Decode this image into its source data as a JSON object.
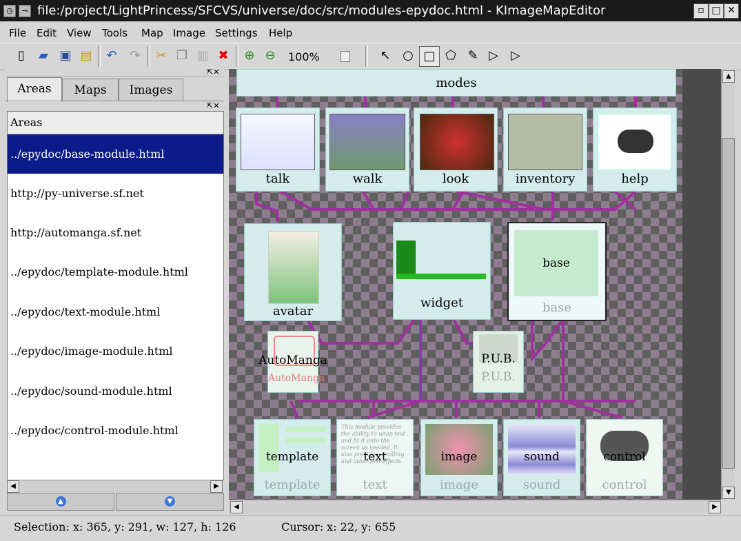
{
  "window": {
    "title": "file:/project/LightPrincess/SFCVS/universe/doc/src/modules-epydoc.html - KImageMapEditor",
    "buttons": {
      "minimize": "▫",
      "maximize": "□",
      "close": "✕"
    }
  },
  "menubar": [
    "File",
    "Edit",
    "View",
    "Tools",
    "Map",
    "Image",
    "Settings",
    "Help"
  ],
  "toolbar": {
    "zoom": "100%"
  },
  "dock": {
    "tabs": [
      "Areas",
      "Maps",
      "Images"
    ],
    "list_header": "Areas",
    "areas": [
      "../epydoc/base-module.html",
      "http://py-universe.sf.net",
      "http://automanga.sf.net",
      "../epydoc/template-module.html",
      "../epydoc/text-module.html",
      "../epydoc/image-module.html",
      "../epydoc/sound-module.html",
      "../epydoc/control-module.html"
    ],
    "selected_index": 0
  },
  "canvas": {
    "modes_label": "modes",
    "top_row": [
      "talk",
      "walk",
      "look",
      "inventory",
      "help"
    ],
    "mid_row": [
      "avatar",
      "widget",
      "base"
    ],
    "base_inner": "base",
    "small": [
      "AutoManga",
      "P.U.B."
    ],
    "bottom_row": [
      "template",
      "text",
      "image",
      "sound",
      "control"
    ],
    "text_thumb": "This module provides the ability to wrap text and fit it onto the screen as needed. It also provides scrolling and other text effects."
  },
  "status": {
    "selection": "Selection: x: 365, y: 291, w: 127, h: 126",
    "cursor": "Cursor: x: 22, y: 655"
  }
}
